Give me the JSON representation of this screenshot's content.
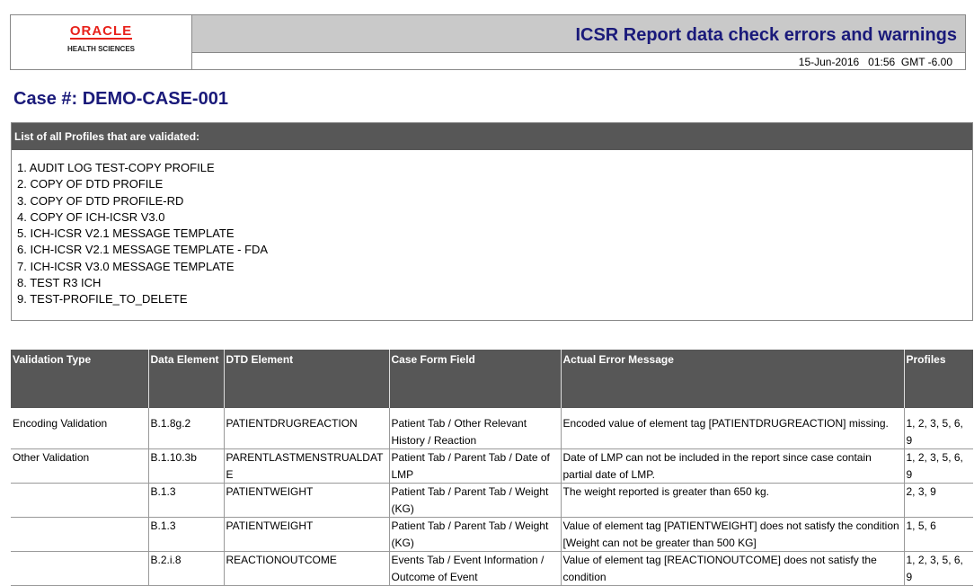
{
  "header": {
    "logo_line1": "ORACLE",
    "logo_line2": "HEALTH SCIENCES",
    "title": "ICSR Report data check errors and warnings",
    "date": "15-Jun-2016   01:56  GMT -6.00"
  },
  "case_title": "Case #: DEMO-CASE-001",
  "profiles": {
    "heading": "List of all Profiles that are validated:",
    "items": [
      "1. AUDIT LOG TEST-COPY PROFILE",
      "2. COPY OF DTD PROFILE",
      "3. COPY OF DTD PROFILE-RD",
      "4. COPY OF ICH-ICSR V3.0",
      "5. ICH-ICSR V2.1 MESSAGE TEMPLATE",
      "6. ICH-ICSR V2.1 MESSAGE TEMPLATE - FDA",
      "7. ICH-ICSR V3.0 MESSAGE TEMPLATE",
      "8. TEST R3 ICH",
      "9. TEST-PROFILE_TO_DELETE"
    ]
  },
  "table": {
    "headers": [
      "Validation Type",
      "Data Element",
      "DTD Element",
      "Case Form Field",
      "Actual Error Message",
      "Profiles"
    ],
    "rows": [
      [
        "Encoding Validation",
        "B.1.8g.2",
        "PATIENTDRUGREACTION",
        "Patient Tab / Other Relevant History / Reaction",
        "Encoded value of element tag [PATIENTDRUGREACTION] missing.",
        "1, 2, 3, 5, 6, 9"
      ],
      [
        "Other Validation",
        "B.1.10.3b",
        "PARENTLASTMENSTRUALDATE",
        "Patient Tab / Parent Tab / Date of LMP",
        "Date of LMP can not be included in the report since case contain partial date of LMP.",
        "1, 2, 3, 5, 6, 9"
      ],
      [
        "",
        "B.1.3",
        "PATIENTWEIGHT",
        "Patient Tab / Parent Tab / Weight (KG)",
        "The weight reported is greater than 650 kg.",
        "2, 3, 9"
      ],
      [
        "",
        "B.1.3",
        "PATIENTWEIGHT",
        "Patient Tab / Parent Tab / Weight (KG)",
        "Value of element tag [PATIENTWEIGHT] does not satisfy the condition [Weight can not be greater than 500 KG]",
        "1, 5, 6"
      ],
      [
        "",
        "B.2.i.8",
        "REACTIONOUTCOME",
        "Events Tab / Event Information / Outcome of Event",
        "Value of element tag [REACTIONOUTCOME] does not satisfy the condition",
        "1, 2, 3, 5, 6, 9"
      ]
    ]
  }
}
